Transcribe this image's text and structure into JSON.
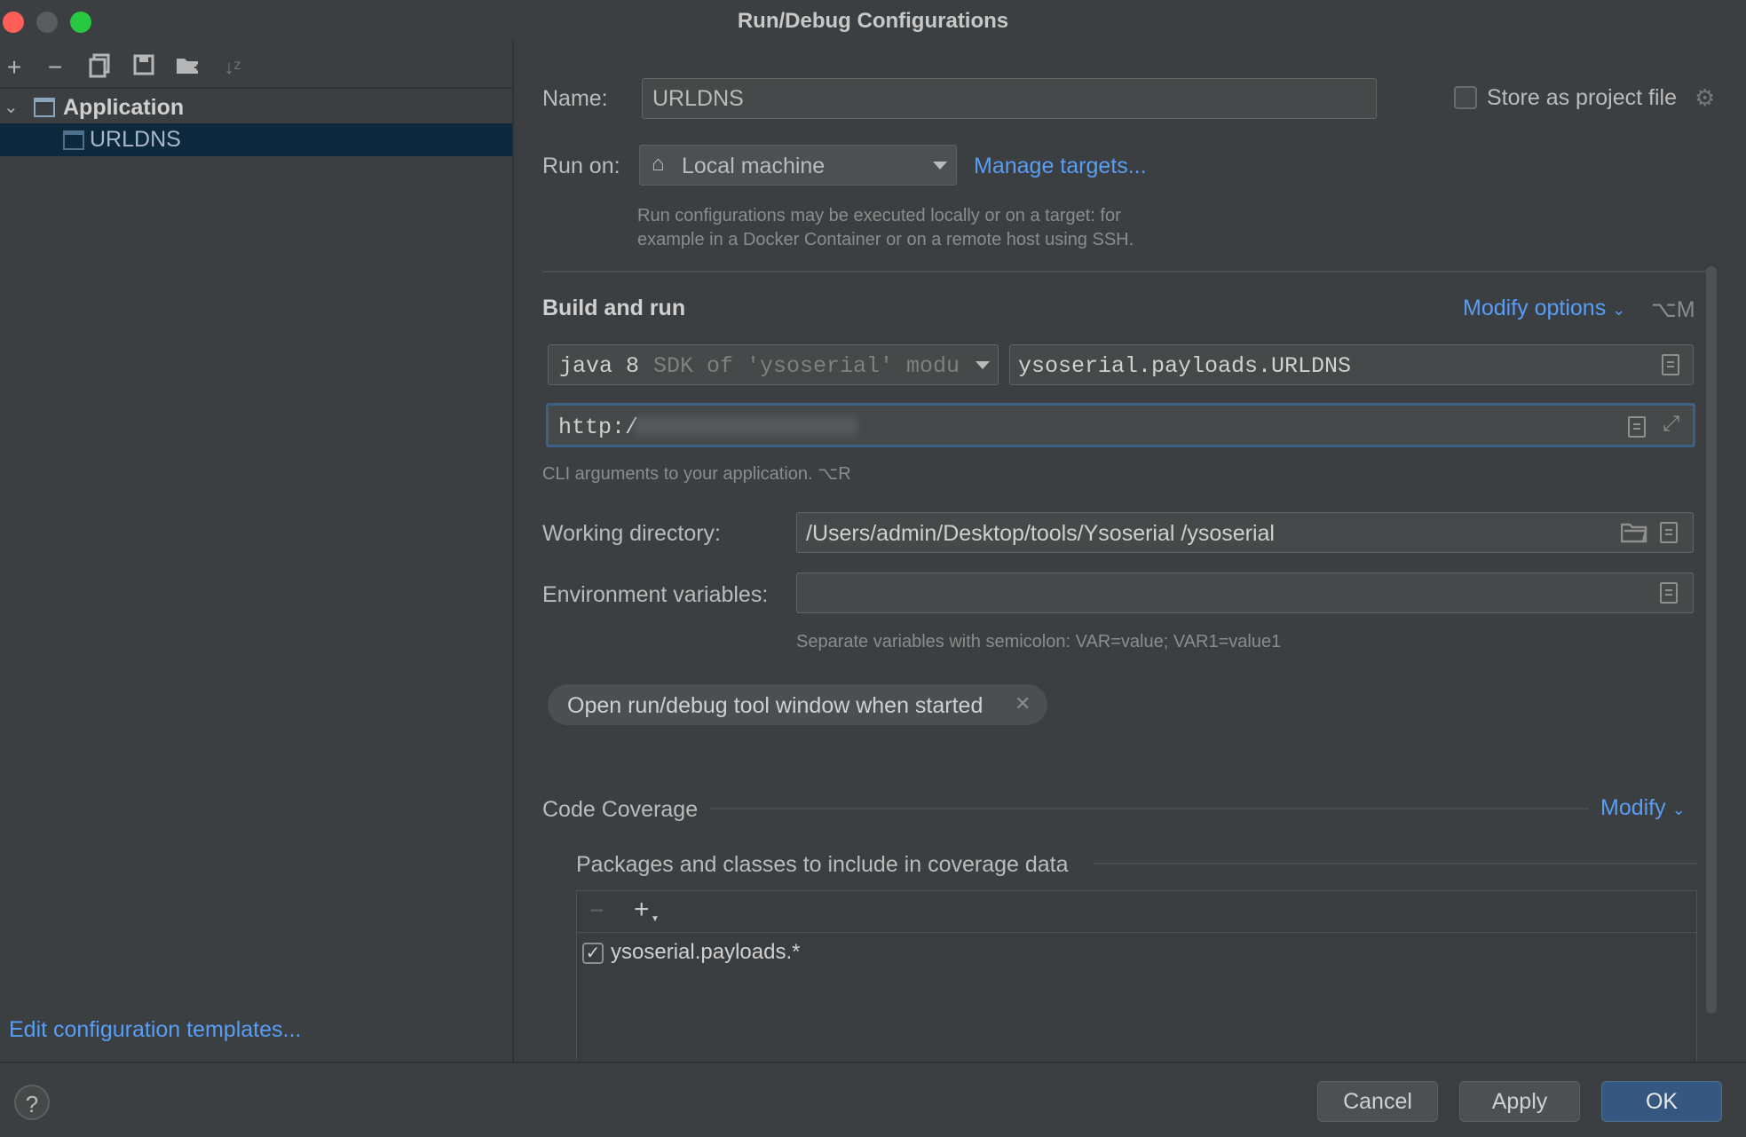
{
  "window": {
    "title": "Run/Debug Configurations"
  },
  "toolbar": {
    "icons": [
      "add-icon",
      "remove-icon",
      "copy-icon",
      "save-icon",
      "new-folder-icon",
      "sort-icon"
    ]
  },
  "tree": {
    "group_label": "Application",
    "selected_item": "URLDNS"
  },
  "left_footer": {
    "edit_templates_label": "Edit configuration templates..."
  },
  "form": {
    "name_label": "Name:",
    "name_value": "URLDNS",
    "store_label": "Store as project file",
    "store_checked": false,
    "run_on_label": "Run on:",
    "run_on_value": "Local machine",
    "manage_targets_label": "Manage targets...",
    "run_on_hint_1": "Run configurations may be executed locally or on a target: for",
    "run_on_hint_2": "example in a Docker Container or on a remote host using SSH.",
    "build_title": "Build and run",
    "modify_options_label": "Modify options",
    "modify_options_shortcut": "⌥M",
    "sdk_main": "java 8",
    "sdk_detail": "SDK of 'ysoserial' modul",
    "main_class": "ysoserial.payloads.URLDNS",
    "program_args": "http:/",
    "cli_hint": "CLI arguments to your application. ⌥R",
    "workdir_label": "Working directory:",
    "workdir_value": "/Users/admin/Desktop/tools/Ysoserial /ysoserial",
    "env_label": "Environment variables:",
    "env_value": "",
    "env_hint": "Separate variables with semicolon: VAR=value; VAR1=value1",
    "chip_label": "Open run/debug tool window when started",
    "coverage_title": "Code Coverage",
    "coverage_modify_label": "Modify",
    "packages_title": "Packages and classes to include in coverage data",
    "packages": [
      {
        "name": "ysoserial.payloads.*",
        "checked": true
      }
    ]
  },
  "buttons": {
    "cancel": "Cancel",
    "apply": "Apply",
    "ok": "OK"
  },
  "colors": {
    "background": "#3c3f41",
    "accent_link": "#589df6",
    "selection": "#0d293e",
    "ok_button": "#365880",
    "focus_border": "#3d6185"
  }
}
